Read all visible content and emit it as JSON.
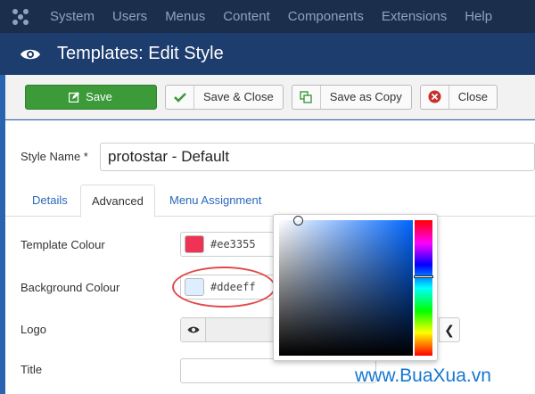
{
  "topnav": {
    "items": [
      "System",
      "Users",
      "Menus",
      "Content",
      "Components",
      "Extensions",
      "Help"
    ]
  },
  "header": {
    "title": "Templates: Edit Style"
  },
  "toolbar": {
    "save_label": "Save",
    "save_close_label": "Save & Close",
    "save_copy_label": "Save as Copy",
    "close_label": "Close"
  },
  "form": {
    "style_name_label": "Style Name *",
    "style_name_value": "protostar - Default"
  },
  "tabs": [
    "Details",
    "Advanced",
    "Menu Assignment"
  ],
  "advanced": {
    "template_colour_label": "Template Colour",
    "template_colour_value": "#ee3355",
    "background_colour_label": "Background Colour",
    "background_colour_value": "#ddeeff",
    "logo_label": "Logo",
    "title_label": "Title"
  },
  "colors": {
    "accent_green": "#3c9a39",
    "nav_bg": "#1b2f4d",
    "header_bg": "#1c3d6e",
    "template_swatch": "#ee3355",
    "background_swatch": "#ddeeff"
  },
  "watermark": "www.BuaXua.vn"
}
